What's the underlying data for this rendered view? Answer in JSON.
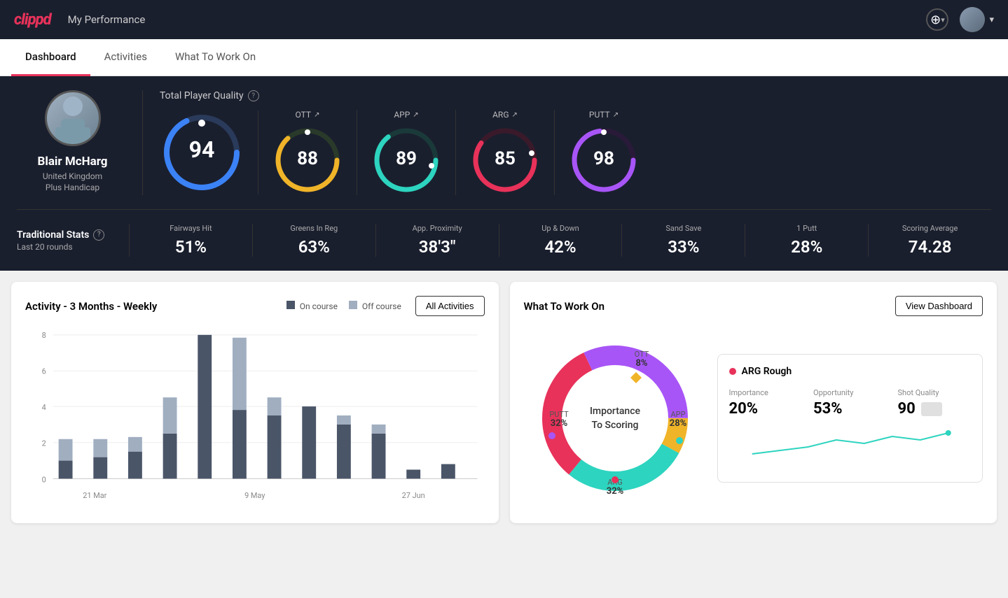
{
  "header": {
    "logo": "clippd",
    "title": "My Performance",
    "add_button_icon": "+",
    "user_chevron": "▾"
  },
  "nav": {
    "tabs": [
      {
        "label": "Dashboard",
        "active": true
      },
      {
        "label": "Activities",
        "active": false
      },
      {
        "label": "What To Work On",
        "active": false
      }
    ]
  },
  "player": {
    "name": "Blair McHarg",
    "country": "United Kingdom",
    "handicap": "Plus Handicap"
  },
  "quality": {
    "title": "Total Player Quality",
    "main_score": 94,
    "metrics": [
      {
        "label": "OTT",
        "score": 88,
        "color": "#f0b429",
        "trend": "↗"
      },
      {
        "label": "APP",
        "score": 89,
        "color": "#2dd4bf",
        "trend": "↗"
      },
      {
        "label": "ARG",
        "score": 85,
        "color": "#e8325a",
        "trend": "↗"
      },
      {
        "label": "PUTT",
        "score": 98,
        "color": "#a855f7",
        "trend": "↗"
      }
    ]
  },
  "trad_stats": {
    "title": "Traditional Stats",
    "subtitle": "Last 20 rounds",
    "items": [
      {
        "label": "Fairways Hit",
        "value": "51%"
      },
      {
        "label": "Greens In Reg",
        "value": "63%"
      },
      {
        "label": "App. Proximity",
        "value": "38'3\""
      },
      {
        "label": "Up & Down",
        "value": "42%"
      },
      {
        "label": "Sand Save",
        "value": "33%"
      },
      {
        "label": "1 Putt",
        "value": "28%"
      },
      {
        "label": "Scoring Average",
        "value": "74.28"
      }
    ]
  },
  "activity_chart": {
    "title": "Activity - 3 Months - Weekly",
    "legend": [
      {
        "label": "On course",
        "color": "#4a5568"
      },
      {
        "label": "Off course",
        "color": "#a0aec0"
      }
    ],
    "all_activities_btn": "All Activities",
    "x_labels": [
      "21 Mar",
      "9 May",
      "27 Jun"
    ],
    "y_labels": [
      "0",
      "2",
      "4",
      "6",
      "8"
    ],
    "bars": [
      {
        "on": 1,
        "off": 1.2
      },
      {
        "on": 1.2,
        "off": 1
      },
      {
        "on": 1.5,
        "off": 0.8
      },
      {
        "on": 2.5,
        "off": 2
      },
      {
        "on": 8.5,
        "off": 0
      },
      {
        "on": 3.8,
        "off": 4
      },
      {
        "on": 3.5,
        "off": 1
      },
      {
        "on": 4,
        "off": 0
      },
      {
        "on": 3,
        "off": 0.5
      },
      {
        "on": 2.5,
        "off": 0.5
      },
      {
        "on": 0.5,
        "off": 0
      },
      {
        "on": 0.8,
        "off": 0
      }
    ]
  },
  "what_to_work_on": {
    "title": "What To Work On",
    "view_dashboard_btn": "View Dashboard",
    "donut": {
      "center_text_line1": "Importance",
      "center_text_line2": "To Scoring",
      "segments": [
        {
          "label": "OTT",
          "pct": 8,
          "color": "#f0b429",
          "position": "top"
        },
        {
          "label": "APP",
          "pct": 28,
          "color": "#2dd4bf",
          "position": "right"
        },
        {
          "label": "ARG",
          "pct": 32,
          "color": "#e8325a",
          "position": "bottom"
        },
        {
          "label": "PUTT",
          "pct": 32,
          "color": "#a855f7",
          "position": "left"
        }
      ]
    },
    "info_card": {
      "title": "ARG Rough",
      "dot_color": "#e8325a",
      "metrics": [
        {
          "label": "Importance",
          "value": "20%"
        },
        {
          "label": "Opportunity",
          "value": "53%"
        },
        {
          "label": "Shot Quality",
          "value": "90"
        }
      ]
    }
  }
}
